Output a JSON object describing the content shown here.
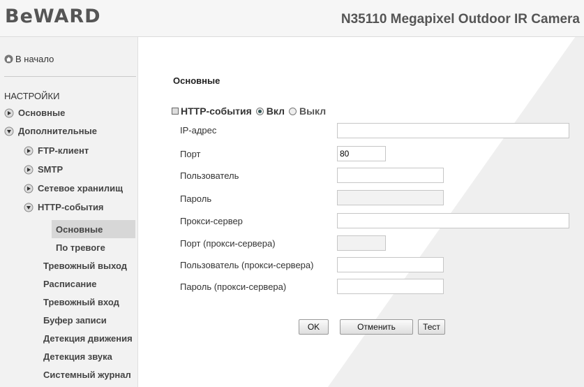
{
  "header": {
    "logo": "BeWARD",
    "camera_title": "N35110 Megapixel Outdoor IR Camera"
  },
  "sidebar": {
    "home": "В начало",
    "settings_heading": "НАСТРОЙКИ",
    "items": [
      {
        "label": "Основные"
      },
      {
        "label": "Дополнительные"
      },
      {
        "label": "FTP-клиент"
      },
      {
        "label": "SMTP"
      },
      {
        "label": "Сетевое хранилищ"
      },
      {
        "label": "HTTP-события"
      },
      {
        "label": "Основные"
      },
      {
        "label": "По тревоге"
      },
      {
        "label": "Тревожный выход"
      },
      {
        "label": "Расписание"
      },
      {
        "label": "Тревожный вход"
      },
      {
        "label": "Буфер записи"
      },
      {
        "label": "Детекция движения"
      },
      {
        "label": "Детекция звука"
      },
      {
        "label": "Системный журнал"
      }
    ]
  },
  "main": {
    "section_title": "Основные",
    "http_events": {
      "label": "HTTP-события",
      "on_label": "Вкл",
      "off_label": "Выкл",
      "selected": "Вкл"
    },
    "fields": [
      {
        "label": "IP-адрес",
        "value": ""
      },
      {
        "label": "Порт",
        "value": "80"
      },
      {
        "label": "Пользователь",
        "value": ""
      },
      {
        "label": "Пароль",
        "value": ""
      },
      {
        "label": "Прокси-сервер",
        "value": ""
      },
      {
        "label": "Порт (прокси-сервера)",
        "value": ""
      },
      {
        "label": "Пользователь (прокси-сервера)",
        "value": ""
      },
      {
        "label": "Пароль (прокси-сервера)",
        "value": ""
      }
    ],
    "buttons": {
      "ok": "OK",
      "cancel": "Отменить",
      "test": "Тест"
    }
  }
}
